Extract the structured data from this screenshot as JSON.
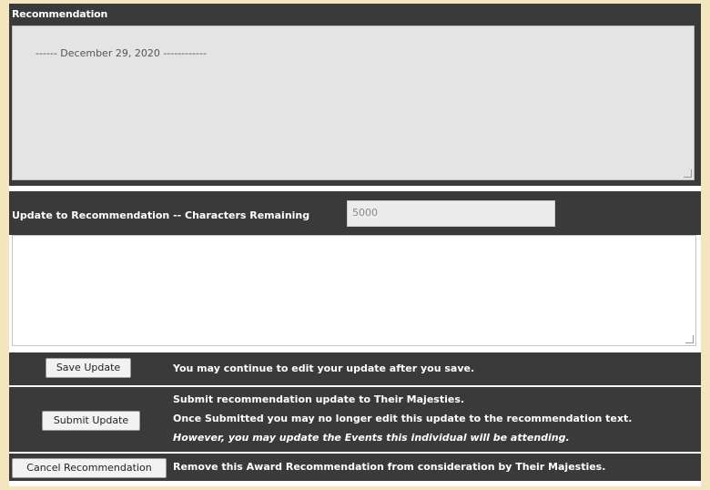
{
  "recommendation": {
    "header_label": "Recommendation",
    "history_text": "------ December 29, 2020 ------------"
  },
  "update": {
    "label": "Update to Recommendation -- Characters Remaining",
    "chars_remaining": "5000",
    "text_value": ""
  },
  "save": {
    "button_label": "Save Update",
    "note": "You may continue to edit your update after you save."
  },
  "submit": {
    "button_label": "Submit Update",
    "note_line1": "Submit recommendation update to Their Majesties.",
    "note_line2": "Once Submitted you may no longer edit this update to the recommendation text.",
    "note_line3": "However, you may update the Events this individual will be attending."
  },
  "cancel": {
    "button_label": "Cancel Recommendation",
    "note": "Remove this Award Recommendation from consideration by Their Majesties."
  }
}
